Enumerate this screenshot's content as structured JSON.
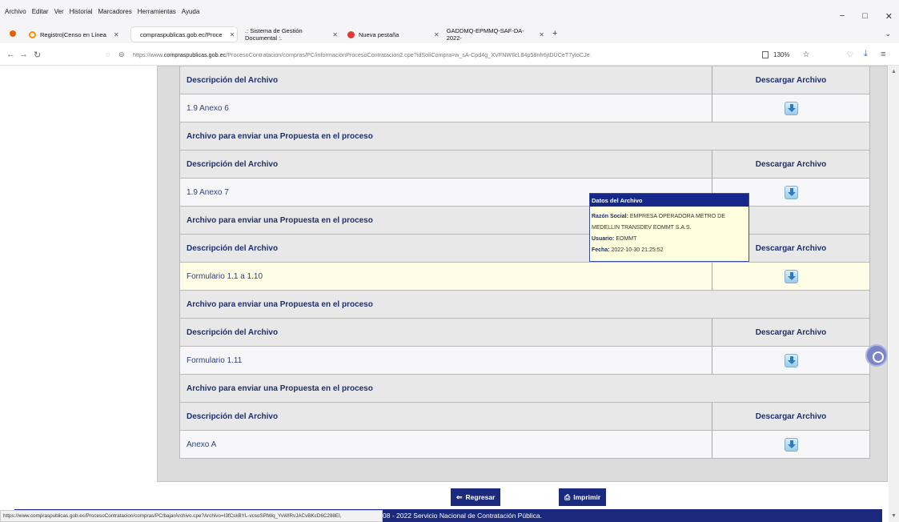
{
  "menu": [
    "Archivo",
    "Editar",
    "Ver",
    "Historial",
    "Marcadores",
    "Herramientas",
    "Ayuda"
  ],
  "window_controls": [
    "−",
    "□",
    "✕"
  ],
  "tabs": [
    {
      "title": "Registro|Censo en Línea",
      "color": "#ff8c00"
    },
    {
      "title": "compraspublicas.gob.ec/Proce",
      "color": "#4caf50"
    },
    {
      "title": ".: Sistema de Gestión Documental :.",
      "color": "#999999"
    },
    {
      "title": "Nueva pestaña",
      "color": "#e53935"
    },
    {
      "title": "GADDMQ-EPMMQ-SAF-DA-2022-",
      "color": "#999999"
    }
  ],
  "url": {
    "prefix": "https://www.",
    "host": "compraspublicas.gob.ec",
    "path": "/ProcesoContratacion/compras/PC/informacionProcesoContratacion2.cpe?idSoliCompra=w_sA-Cpd4g_XVFNWIlcL84p58nfr6jtDUCeT7yIoCJe."
  },
  "zoom": "130%",
  "sections": {
    "desc_header": "Descripción del Archivo",
    "download_header": "Descargar Archivo",
    "section_title": "Archivo para enviar una Propuesta en el proceso"
  },
  "rows": [
    "1.9 Anexo 6",
    "1.9 Anexo 7",
    "Formulario 1.1 a 1.10",
    "Formulario 1.11",
    "Anexo A"
  ],
  "tooltip": {
    "title": "Datos del Archivo",
    "razon_label": "Razón Social:",
    "razon_value": "EMPRESA OPERADORA METRO DE MEDELLIN TRANSDEV EOMMT S.A.S.",
    "usuario_label": "Usuario:",
    "usuario_value": "EOMMT",
    "fecha_label": "Fecha:",
    "fecha_value": "2022-10-30 21:25:52"
  },
  "buttons": {
    "regresar": "Regresar",
    "imprimir": "Imprimir"
  },
  "footer": "08 - 2022 Servicio Nacional de Contratación Pública.",
  "status_url": "https://www.compraspublicas.gob.ec/ProcesoContratacion/compras/PC/bajarArchivo.cpe?Archivo=I3fCskBYL-vcsoSPlWq_YvWlRvJACvBKcD6C298EI,"
}
